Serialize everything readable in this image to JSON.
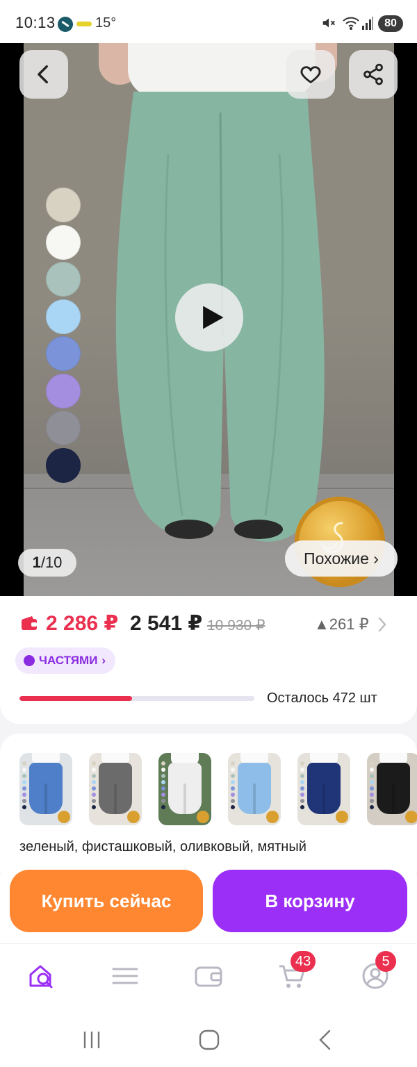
{
  "status_bar": {
    "time": "10:13",
    "temperature": "15°",
    "battery": "80"
  },
  "gallery": {
    "counter_current": "1",
    "counter_separator": "/",
    "counter_total": "10",
    "similar_label": "Похожие ›",
    "swatches": [
      "#d8d2c3",
      "#f7f7f4",
      "#a9c2bb",
      "#aad6f5",
      "#7b93d8",
      "#a48ee0",
      "#8f8f98",
      "#1d2545"
    ],
    "pants_color": "#86b5a2"
  },
  "price": {
    "current": "2 286 ₽",
    "alt": "2 541 ₽",
    "old": "10 930 ₽",
    "delta": "▲261 ₽",
    "installments_label": "ЧАСТЯМИ",
    "stock_progress_fraction": 0.48,
    "stock_label": "Осталось 472 шт"
  },
  "variants": {
    "thumbnails": [
      {
        "name": "blue",
        "color": "#4e7fc8",
        "bg": "#dfe3e6"
      },
      {
        "name": "gray",
        "color": "#6b6b6b",
        "bg": "#e7e3dc"
      },
      {
        "name": "white",
        "color": "#eeeeee",
        "bg": "#5f7c56"
      },
      {
        "name": "light-blue",
        "color": "#8dbde8",
        "bg": "#e6e3dd"
      },
      {
        "name": "navy",
        "color": "#1f3578",
        "bg": "#e5e2dc"
      },
      {
        "name": "black",
        "color": "#1b1b1b",
        "bg": "#d3cdc3"
      }
    ],
    "selected_name": "зеленый, фисташковый, оливковый, мятный"
  },
  "actions": {
    "buy_now": "Купить сейчас",
    "add_to_cart": "В корзину"
  },
  "bottom_nav": {
    "cart_badge": "43",
    "profile_badge": "5"
  },
  "colors": {
    "accent_purple": "#9b2ff7",
    "accent_orange": "#ff8731",
    "price_red": "#ea2f4f"
  },
  "icons": [
    "back-icon",
    "heart-icon",
    "share-icon",
    "play-icon",
    "search-home-icon",
    "menu-icon",
    "wallet-icon",
    "cart-icon",
    "profile-icon",
    "recents-icon",
    "home-icon",
    "back-nav-icon"
  ]
}
